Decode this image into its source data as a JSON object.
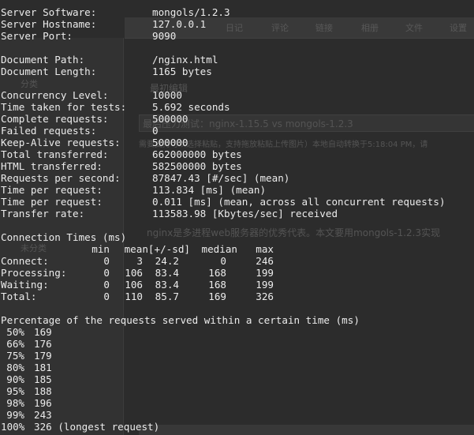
{
  "background_editor": {
    "tabs": [
      "日记",
      "评论",
      "链接",
      "相册",
      "文件",
      "设置"
    ],
    "sidebar": [
      "分类",
      "未分类"
    ],
    "fields": {
      "tags_label": "最初编辑",
      "title_value": "最后压力测试：nginx-1.15.5 vs mongols-1.2.3",
      "hint": "需要支持可以选择粘贴，支持拖放粘贴上传图片）本地自动转换于5:18:04 PM，请",
      "body": "nginx是多进程web服务器的优秀代表。本文要用mongols-1.2.3实现",
      "body_link": "mongols"
    }
  },
  "terminal": {
    "server": [
      {
        "label": "Server Software:",
        "value": "mongols/1.2.3"
      },
      {
        "label": "Server Hostname:",
        "value": "127.0.0.1"
      },
      {
        "label": "Server Port:",
        "value": "9090"
      }
    ],
    "document": [
      {
        "label": "Document Path:",
        "value": "/nginx.html"
      },
      {
        "label": "Document Length:",
        "value": "1165 bytes"
      }
    ],
    "stats": [
      {
        "label": "Concurrency Level:",
        "value": "10000"
      },
      {
        "label": "Time taken for tests:",
        "value": "5.692 seconds"
      },
      {
        "label": "Complete requests:",
        "value": "500000"
      },
      {
        "label": "Failed requests:",
        "value": "0"
      },
      {
        "label": "Keep-Alive requests:",
        "value": "500000"
      },
      {
        "label": "Total transferred:",
        "value": "662000000 bytes"
      },
      {
        "label": "HTML transferred:",
        "value": "582500000 bytes"
      },
      {
        "label": "Requests per second:",
        "value": "87847.43 [#/sec] (mean)"
      },
      {
        "label": "Time per request:",
        "value": "113.834 [ms] (mean)"
      },
      {
        "label": "Time per request:",
        "value": "0.011 [ms] (mean, across all concurrent requests)"
      },
      {
        "label": "Transfer rate:",
        "value": "113583.98 [Kbytes/sec] received"
      }
    ],
    "connection_times": {
      "title": "Connection Times (ms)",
      "headers": [
        "min",
        "mean[+/-sd]",
        "median",
        "max"
      ],
      "rows": [
        {
          "name": "Connect:",
          "min": "0",
          "mean": "3",
          "sd": "24.2",
          "median": "0",
          "max": "246"
        },
        {
          "name": "Processing:",
          "min": "0",
          "mean": "106",
          "sd": "83.4",
          "median": "168",
          "max": "199"
        },
        {
          "name": "Waiting:",
          "min": "0",
          "mean": "106",
          "sd": "83.4",
          "median": "168",
          "max": "199"
        },
        {
          "name": "Total:",
          "min": "0",
          "mean": "110",
          "sd": "85.7",
          "median": "169",
          "max": "326"
        }
      ]
    },
    "percentiles": {
      "title": "Percentage of the requests served within a certain time (ms)",
      "rows": [
        {
          "pct": "50%",
          "ms": "169"
        },
        {
          "pct": "66%",
          "ms": "176"
        },
        {
          "pct": "75%",
          "ms": "179"
        },
        {
          "pct": "80%",
          "ms": "181"
        },
        {
          "pct": "90%",
          "ms": "185"
        },
        {
          "pct": "95%",
          "ms": "188"
        },
        {
          "pct": "98%",
          "ms": "196"
        },
        {
          "pct": "99%",
          "ms": "243"
        },
        {
          "pct": "100%",
          "ms": "326 (longest request)"
        }
      ]
    }
  },
  "colors": {
    "terminal_bg": "#2c2c2c",
    "terminal_fg": "#ececec"
  }
}
